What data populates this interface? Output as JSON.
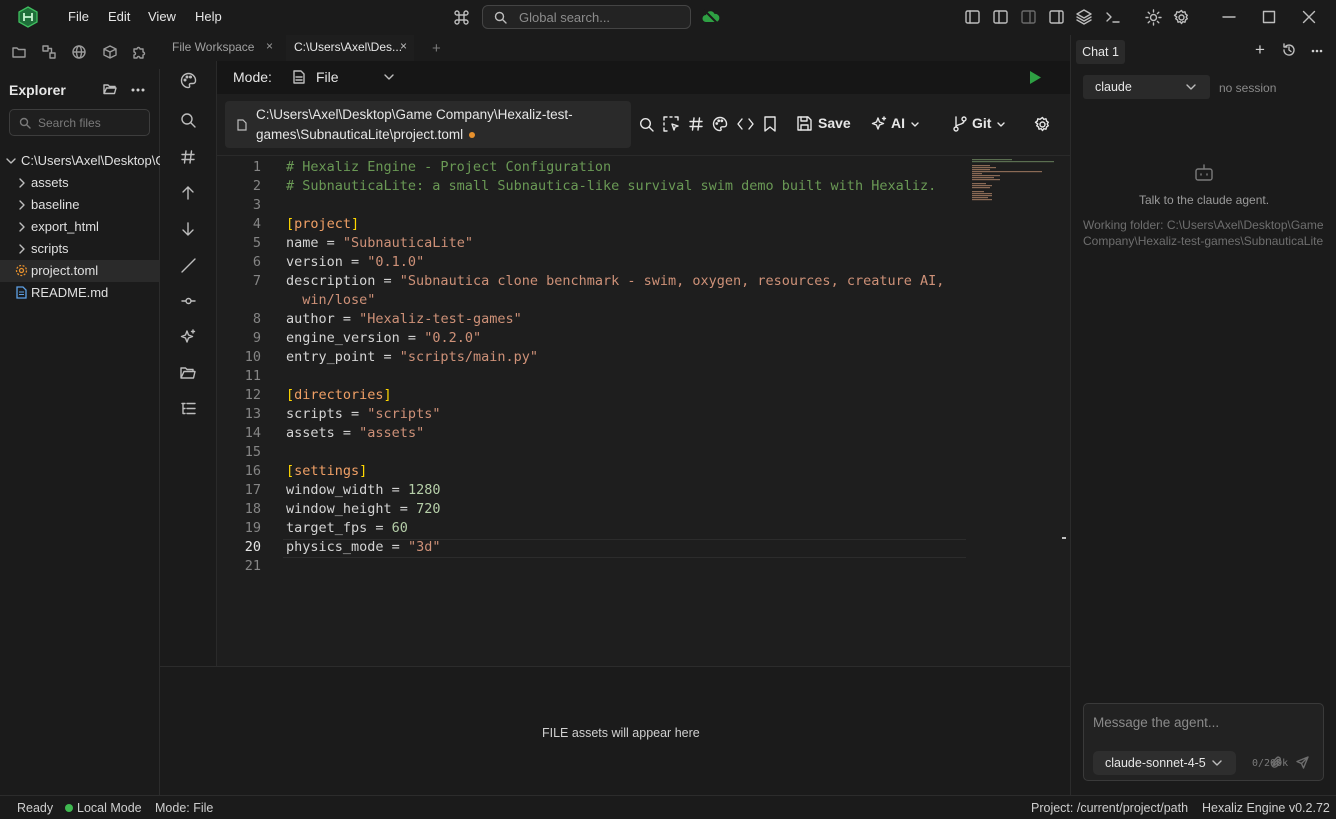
{
  "app": {
    "logo_icon": "hexaliz-logo-icon"
  },
  "menu": [
    "File",
    "Edit",
    "View",
    "Help"
  ],
  "search": {
    "placeholder": "Global search..."
  },
  "explorer": {
    "title": "Explorer",
    "search_placeholder": "Search files",
    "root": "C:\\Users\\Axel\\Desktop\\G",
    "items": [
      {
        "label": "assets",
        "type": "folder"
      },
      {
        "label": "baseline",
        "type": "folder"
      },
      {
        "label": "export_html",
        "type": "folder"
      },
      {
        "label": "scripts",
        "type": "folder"
      },
      {
        "label": "project.toml",
        "type": "file",
        "selected": true
      },
      {
        "label": "README.md",
        "type": "file"
      }
    ]
  },
  "tabs": [
    {
      "label": "File Workspace",
      "active": false
    },
    {
      "label": "C:\\Users\\Axel\\Des...",
      "active": true
    }
  ],
  "mode": {
    "label": "Mode:",
    "value": "File"
  },
  "editor": {
    "path_line1": "C:\\Users\\Axel\\Desktop\\Game Company\\Hexaliz-test-",
    "path_line2": "games\\SubnauticaLite\\project.toml",
    "save_label": "Save",
    "ai_label": "AI",
    "git_label": "Git",
    "current_line": 20
  },
  "code": [
    {
      "n": "1",
      "t": [
        [
          "c-com",
          "# Hexaliz Engine - Project Configuration"
        ]
      ]
    },
    {
      "n": "2",
      "t": [
        [
          "c-com",
          "# SubnauticaLite: a small Subnautica-like survival swim demo built with Hexaliz."
        ]
      ]
    },
    {
      "n": "3",
      "t": []
    },
    {
      "n": "4",
      "t": [
        [
          "c-br",
          "["
        ],
        [
          "c-sec",
          "project"
        ],
        [
          "c-br",
          "]"
        ]
      ]
    },
    {
      "n": "5",
      "t": [
        [
          "c-key",
          "name"
        ],
        [
          "",
          " = "
        ],
        [
          "c-str",
          "\"SubnauticaLite\""
        ]
      ]
    },
    {
      "n": "6",
      "t": [
        [
          "c-key",
          "version"
        ],
        [
          "",
          " = "
        ],
        [
          "c-str",
          "\"0.1.0\""
        ]
      ]
    },
    {
      "n": "7",
      "t": [
        [
          "c-key",
          "description"
        ],
        [
          "",
          " = "
        ],
        [
          "c-str",
          "\"Subnautica clone benchmark - swim, oxygen, resources, creature AI,"
        ]
      ]
    },
    {
      "n": "",
      "t": [
        [
          "c-str",
          "  win/lose\""
        ]
      ]
    },
    {
      "n": "8",
      "t": [
        [
          "c-key",
          "author"
        ],
        [
          "",
          " = "
        ],
        [
          "c-str",
          "\"Hexaliz-test-games\""
        ]
      ]
    },
    {
      "n": "9",
      "t": [
        [
          "c-key",
          "engine_version"
        ],
        [
          "",
          " = "
        ],
        [
          "c-str",
          "\"0.2.0\""
        ]
      ]
    },
    {
      "n": "10",
      "t": [
        [
          "c-key",
          "entry_point"
        ],
        [
          "",
          " = "
        ],
        [
          "c-str",
          "\"scripts/main.py\""
        ]
      ]
    },
    {
      "n": "11",
      "t": []
    },
    {
      "n": "12",
      "t": [
        [
          "c-br",
          "["
        ],
        [
          "c-sec",
          "directories"
        ],
        [
          "c-br",
          "]"
        ]
      ]
    },
    {
      "n": "13",
      "t": [
        [
          "c-key",
          "scripts"
        ],
        [
          "",
          " = "
        ],
        [
          "c-str",
          "\"scripts\""
        ]
      ]
    },
    {
      "n": "14",
      "t": [
        [
          "c-key",
          "assets"
        ],
        [
          "",
          " = "
        ],
        [
          "c-str",
          "\"assets\""
        ]
      ]
    },
    {
      "n": "15",
      "t": []
    },
    {
      "n": "16",
      "t": [
        [
          "c-br",
          "["
        ],
        [
          "c-sec",
          "settings"
        ],
        [
          "c-br",
          "]"
        ]
      ]
    },
    {
      "n": "17",
      "t": [
        [
          "c-key",
          "window_width"
        ],
        [
          "",
          " = "
        ],
        [
          "c-num",
          "1280"
        ]
      ]
    },
    {
      "n": "18",
      "t": [
        [
          "c-key",
          "window_height"
        ],
        [
          "",
          " = "
        ],
        [
          "c-num",
          "720"
        ]
      ]
    },
    {
      "n": "19",
      "t": [
        [
          "c-key",
          "target_fps"
        ],
        [
          "",
          " = "
        ],
        [
          "c-num",
          "60"
        ]
      ]
    },
    {
      "n": "20",
      "t": [
        [
          "c-key",
          "physics_mode"
        ],
        [
          "",
          " = "
        ],
        [
          "c-str",
          "\"3d\""
        ]
      ]
    },
    {
      "n": "21",
      "t": []
    }
  ],
  "assets_panel": {
    "empty_text": "FILE assets will appear here"
  },
  "chat": {
    "tab_label": "Chat 1",
    "agent": "claude",
    "session": "no session",
    "empty_title": "Talk to the claude agent.",
    "working_folder_line1": "Working folder: C:\\Users\\Axel\\Desktop\\Game",
    "working_folder_line2": "Company\\Hexaliz-test-games\\SubnauticaLite",
    "input_placeholder": "Message the agent...",
    "model": "claude-sonnet-4-5",
    "char_count": "0/200k"
  },
  "status": {
    "ready": "Ready",
    "local_mode": "Local Mode",
    "mode": "Mode: File",
    "project": "Project: /current/project/path",
    "version": "Hexaliz Engine v0.2.72"
  },
  "colors": {
    "accent_green": "#2ea043",
    "modified_dot": "#e8912d",
    "status_dot": "#3fb950"
  }
}
